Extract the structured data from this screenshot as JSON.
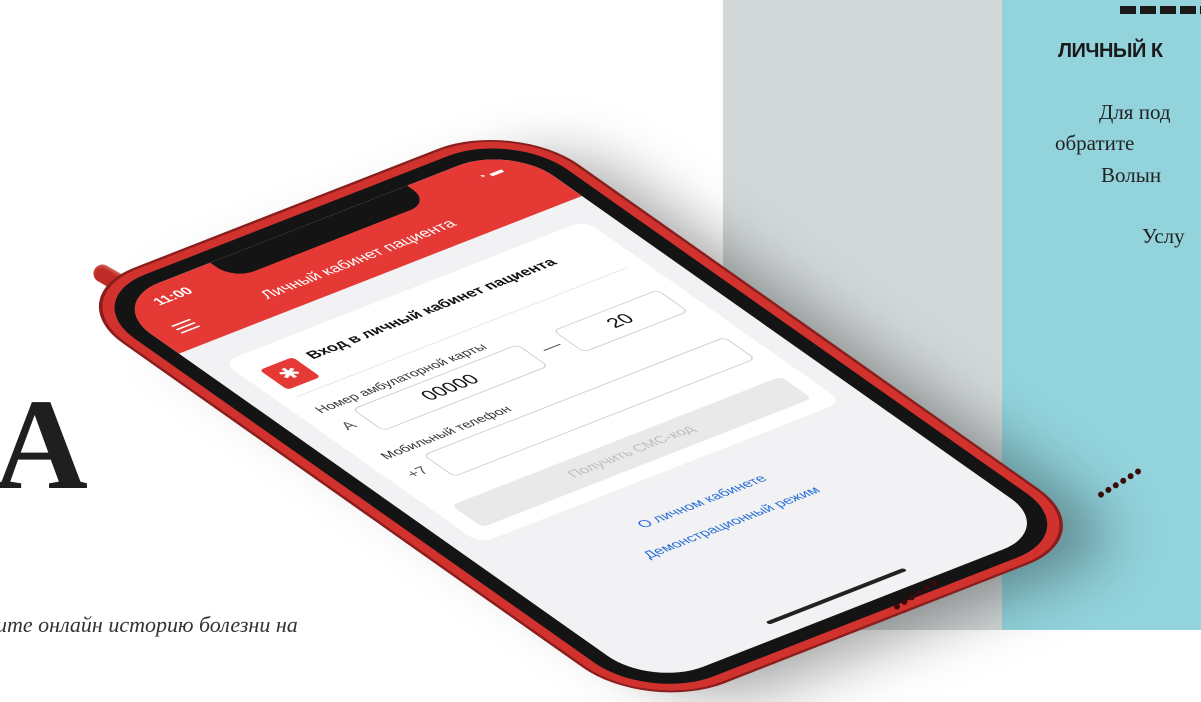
{
  "background": {
    "side_heading": "ЛИЧНЫЙ К",
    "side_lines": [
      "Для под",
      "обратите",
      "Волын",
      "Услу"
    ],
    "big_letter": "А",
    "bottom_italic": "ите онлайн историю болезни на"
  },
  "phone": {
    "status_time": "11:00",
    "app_title": "Личный кабинет пациента",
    "card": {
      "title": "Вход в личный кабинет пациента",
      "card_number_label": "Номер амбулаторной карты",
      "card_prefix": "А",
      "card_number_value": "00000",
      "card_suffix_value": "20",
      "phone_label": "Мобильный телефон",
      "phone_prefix": "+7",
      "sms_button": "Получить СМС-код"
    },
    "links": {
      "about": "О личном кабинете",
      "demo": "Демонстрационный режим"
    }
  },
  "colors": {
    "accent_red": "#e53935",
    "link_blue": "#2a6fd6",
    "panel_teal": "#92d3dc",
    "panel_gray": "#d2d8d8"
  }
}
